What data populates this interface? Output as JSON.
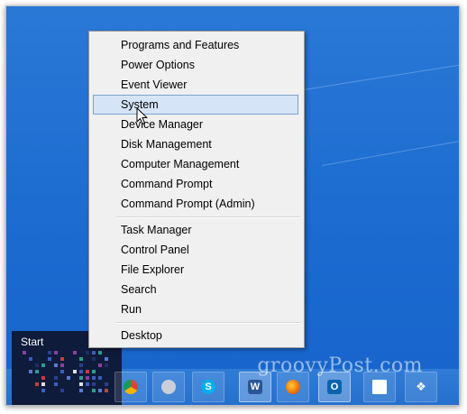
{
  "menu": {
    "items": [
      "Programs and Features",
      "Power Options",
      "Event Viewer",
      "System",
      "Device Manager",
      "Disk Management",
      "Computer Management",
      "Command Prompt",
      "Command Prompt (Admin)",
      "Task Manager",
      "Control Panel",
      "File Explorer",
      "Search",
      "Run",
      "Desktop"
    ],
    "highlighted": "System"
  },
  "start": {
    "label": "Start"
  },
  "taskbar": {
    "icons": [
      "chrome-icon",
      "mail-app-icon",
      "skype-icon",
      "word-icon",
      "firefox-icon",
      "outlook-icon",
      "document-icon",
      "dropbox-icon"
    ]
  },
  "watermark": "groovyPost.com",
  "colors": {
    "desktop": "#1a6ad0",
    "highlight": "#d5e4f7",
    "highlight_border": "#7da2ce",
    "start_tile": "#0f1b3a"
  }
}
